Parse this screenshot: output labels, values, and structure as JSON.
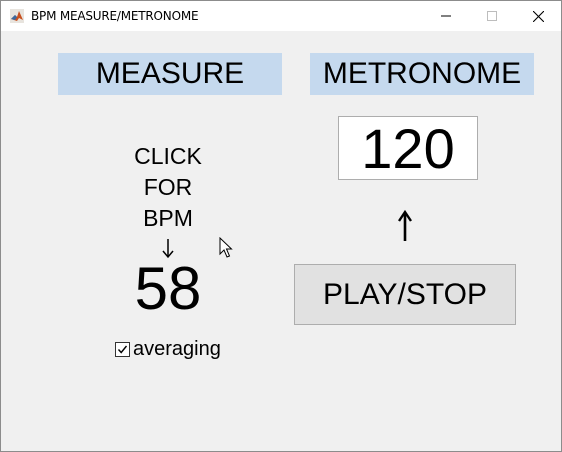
{
  "window": {
    "title": "BPM MEASURE/METRONOME",
    "icon": "matlab-icon",
    "controls": {
      "minimize": "minimize-icon",
      "maximize": "maximize-icon",
      "close": "close-icon"
    }
  },
  "measure": {
    "title": "MEASURE",
    "prompt_lines": [
      "CLICK",
      "FOR",
      "BPM"
    ],
    "arrow_icon": "arrow-down-icon",
    "bpm_value": "58",
    "averaging": {
      "label": "averaging",
      "checked": true
    }
  },
  "metronome": {
    "title": "METRONOME",
    "tempo_value": "120",
    "arrow_icon": "arrow-up-icon",
    "play_stop_label": "PLAY/STOP"
  },
  "colors": {
    "panel_title_bg": "#c5d9ee",
    "window_bg": "#f0f0f0",
    "button_bg": "#e1e1e1"
  }
}
